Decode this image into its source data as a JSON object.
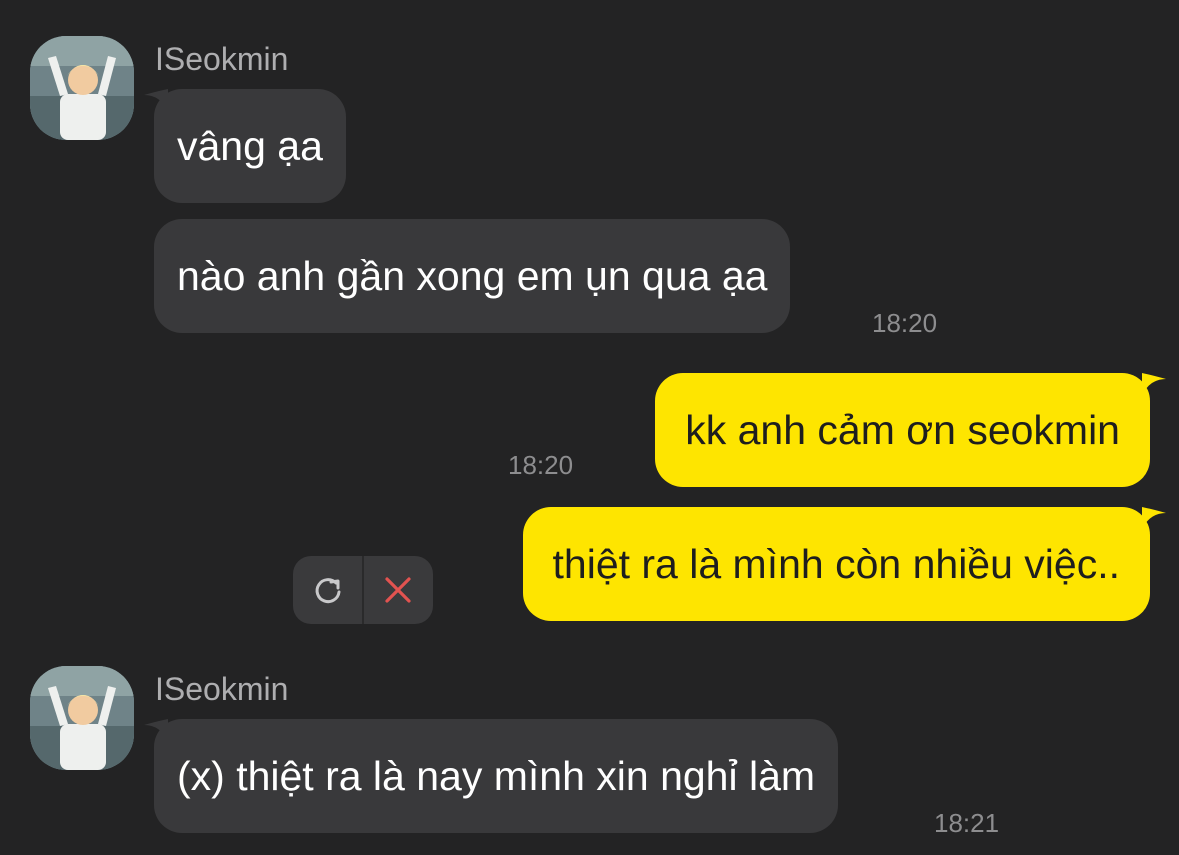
{
  "conversation": {
    "group1": {
      "sender": "ISeokmin",
      "messages": [
        {
          "text": "vâng ạa"
        },
        {
          "text": "nào anh gần xong em ụn qua ạa",
          "time": "18:20"
        }
      ]
    },
    "outgoing": [
      {
        "text": "kk anh cảm ơn seokmin",
        "time": "18:20"
      },
      {
        "text": "thiệt ra là mình còn nhiều việc..",
        "status": "failed"
      }
    ],
    "failed_actions": {
      "retry_icon": "refresh-icon",
      "delete_icon": "close-icon"
    },
    "group2": {
      "sender": "ISeokmin",
      "messages": [
        {
          "text": "(x) thiệt ra là nay mình xin nghỉ làm",
          "time": "18:21"
        }
      ]
    }
  },
  "colors": {
    "background": "#232324",
    "incoming_bubble": "#39393b",
    "outgoing_bubble": "#fee500",
    "delete_red": "#e25350"
  }
}
